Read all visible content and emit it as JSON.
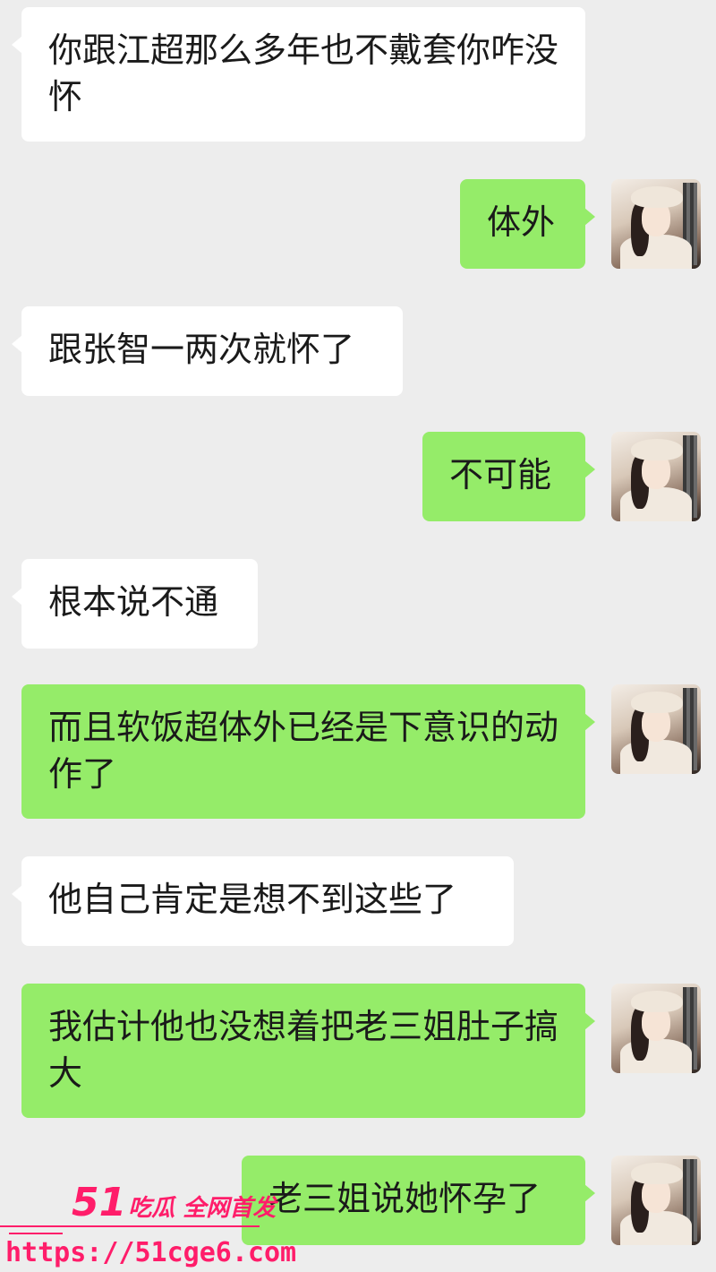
{
  "messages": [
    {
      "side": "in",
      "text": "你跟江超那么多年也不戴套你咋没怀"
    },
    {
      "side": "out",
      "text": "体外"
    },
    {
      "side": "in",
      "text": "跟张智一两次就怀了"
    },
    {
      "side": "out",
      "text": "不可能"
    },
    {
      "side": "in",
      "text": "根本说不通"
    },
    {
      "side": "out",
      "text": "而且软饭超体外已经是下意识的动作了"
    },
    {
      "side": "in",
      "text": "他自己肯定是想不到这些了"
    },
    {
      "side": "out",
      "text": "我估计他也没想着把老三姐肚子搞大"
    },
    {
      "side": "out",
      "text": "老三姐说她怀孕了"
    }
  ],
  "watermark": {
    "number": "51",
    "text": "吃瓜 全网首发",
    "url": "https://51cge6.com"
  },
  "colors": {
    "background": "#ededed",
    "bubble_in": "#ffffff",
    "bubble_out": "#95ec69",
    "watermark": "#ff1d6a"
  },
  "icons": {
    "avatar": "avatar-woman-beret"
  }
}
